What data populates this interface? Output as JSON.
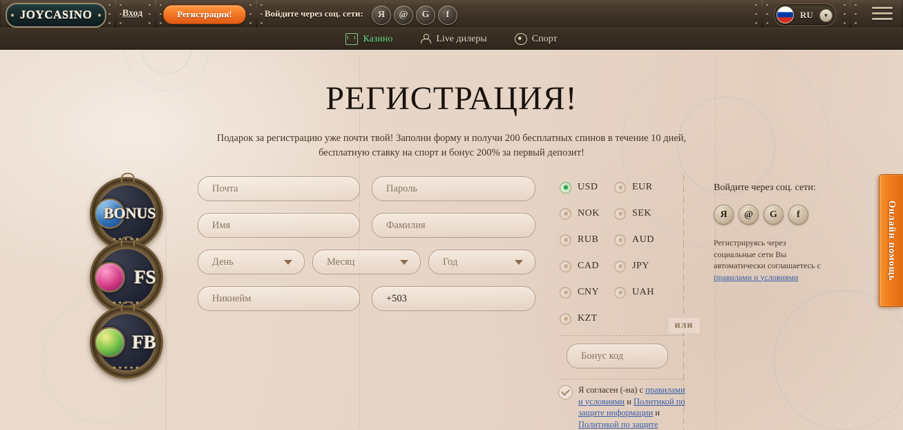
{
  "header": {
    "logo": "JOYCASINO",
    "login_label": "Вход",
    "register_label": "Регистрация!",
    "social_label": "Войдите через соц. сети:",
    "social_icons": [
      {
        "name": "yandex-icon",
        "glyph": "Я"
      },
      {
        "name": "mailru-icon",
        "glyph": "@"
      },
      {
        "name": "google-icon",
        "glyph": "G"
      },
      {
        "name": "facebook-icon",
        "glyph": "f"
      }
    ],
    "language": "RU",
    "menu_icon": "hamburger-icon"
  },
  "nav": {
    "items": [
      {
        "label": "Казино",
        "icon": "casino-icon",
        "active": true
      },
      {
        "label": "Live дилеры",
        "icon": "live-dealer-icon",
        "active": false
      },
      {
        "label": "Спорт",
        "icon": "sport-icon",
        "active": false
      }
    ]
  },
  "page": {
    "title": "РЕГИСТРАЦИЯ!",
    "subtitle": "Подарок за регистрацию уже почти твой! Заполни форму и получи 200 бесплатных спинов в течение 10 дней, бесплатную ставку на спорт и бонус 200% за первый депозит!"
  },
  "medallions": [
    {
      "label": "BONUS",
      "gem": "blue"
    },
    {
      "label": "FS",
      "gem": "pink"
    },
    {
      "label": "FB",
      "gem": "green"
    }
  ],
  "form": {
    "email": {
      "placeholder": "Почта",
      "value": ""
    },
    "password": {
      "placeholder": "Пароль",
      "value": ""
    },
    "first_name": {
      "placeholder": "Имя",
      "value": ""
    },
    "last_name": {
      "placeholder": "Фамилия",
      "value": ""
    },
    "day": {
      "placeholder": "День",
      "value": ""
    },
    "month": {
      "placeholder": "Месяц",
      "value": ""
    },
    "year": {
      "placeholder": "Год",
      "value": ""
    },
    "nickname": {
      "placeholder": "Никнейм",
      "value": ""
    },
    "phone": {
      "placeholder": "",
      "value": "+503"
    },
    "bonus_code": {
      "placeholder": "Бонус код",
      "value": ""
    }
  },
  "currencies": {
    "selected": "USD",
    "rows": [
      [
        {
          "code": "USD",
          "selected": true
        },
        {
          "code": "EUR",
          "selected": false
        }
      ],
      [
        {
          "code": "NOK",
          "selected": false
        },
        {
          "code": "SEK",
          "selected": false
        }
      ],
      [
        {
          "code": "RUB",
          "selected": false
        },
        {
          "code": "AUD",
          "selected": false
        }
      ],
      [
        {
          "code": "CAD",
          "selected": false
        },
        {
          "code": "JPY",
          "selected": false
        }
      ],
      [
        {
          "code": "CNY",
          "selected": false
        },
        {
          "code": "UAH",
          "selected": false
        }
      ],
      [
        {
          "code": "KZT",
          "selected": false
        }
      ]
    ]
  },
  "divider": {
    "or_label": "или"
  },
  "agreement": {
    "checked": true,
    "prefix": "Я согласен (-на) с ",
    "link1": "правилами и условиями",
    "mid1": " и ",
    "link2": "Политикой по защите информации",
    "mid2": " и ",
    "link3": "Политикой по защите"
  },
  "social_panel": {
    "heading": "Войдите через соц. сети:",
    "icons": [
      {
        "name": "yandex-icon",
        "glyph": "Я"
      },
      {
        "name": "mailru-icon",
        "glyph": "@"
      },
      {
        "name": "google-icon",
        "glyph": "G"
      },
      {
        "name": "facebook-icon",
        "glyph": "f"
      }
    ],
    "note_prefix": "Регистрируясь через социальные сети Вы автоматически соглашаетесь с ",
    "note_link": "правилами и условиями"
  },
  "help_tab": {
    "label": "Онлайн помощь"
  },
  "colors": {
    "accent_orange": "#f07c1c",
    "header_brown": "#3d3126",
    "nav_brown": "#362c21",
    "parchment": "#e8d7ca",
    "active_green": "#79c88a",
    "link_blue": "#3a5fa8"
  }
}
